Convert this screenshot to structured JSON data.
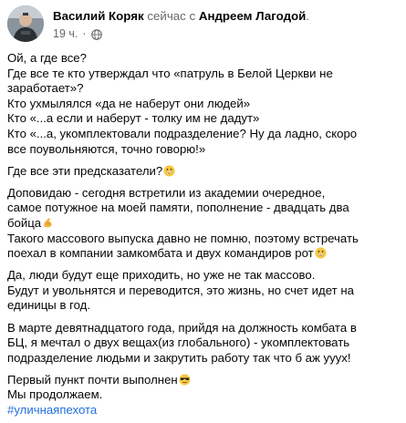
{
  "post": {
    "author": "Василий Коряк",
    "activity": "сейчас с",
    "tagged": "Андреем Лагодой",
    "tagged_suffix": ".",
    "time": "19 ч.",
    "separator": "·",
    "paragraphs": [
      {
        "lines": [
          "Ой, а где все?",
          "Где все те кто утверждал что «патруль в Белой Церкви не",
          "заработает»?",
          "Кто ухмылялся «да не наберут они людей»",
          "Кто «...а если и наберут - толку им не дадут»",
          "Кто «...а, укомплектовали подразделение? Ну да ладно, скоро",
          "все поувольняются, точно говорю!»"
        ]
      },
      {
        "lines": [
          "Где все эти предсказатели?"
        ],
        "emoji_line": 0,
        "emoji": "grin-emoji"
      },
      {
        "lines": [
          "Доповидаю - сегодня встретили из академии очередное,",
          "самое потужное на моей памяти, пополнение - двадцать два",
          "бойца",
          "Такого массового выпуска давно не помню, поэтому встречать",
          "поехал в компании замкомбата и двух командиров рот"
        ]
      },
      {
        "lines": [
          "Да, люди будут еще приходить, но уже не так массово.",
          "Будут и увольнятся и переводится, это жизнь, но счет идет на",
          "единицы в год."
        ]
      },
      {
        "lines": [
          "В марте девятнадцатого года, прийдя на должность комбата в",
          "БЦ, я мечтал о двух вещах(из глобального) - укомплектовать",
          "подразделение людьми и закрутить работу так что б аж ууух!"
        ]
      },
      {
        "lines": [
          "Первый пункт почти выполнен",
          "Мы продолжаем."
        ]
      }
    ],
    "hashtag": "#уличнаяпехота"
  }
}
